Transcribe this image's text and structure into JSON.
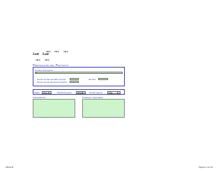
{
  "header": {
    "small_labels_row1": [
      "ABLE",
      "ABLE",
      "ABLE"
    ],
    "logo_left": "Lote",
    "logo_right": "Lote",
    "small_labels_row2": [
      "ABLE",
      "ABLE"
    ]
  },
  "section": {
    "title": "Preparación del Proyecto"
  },
  "project": {
    "name_label": "Nombre del proyecto:",
    "name_value": "0",
    "row1_label": "Número de días que faltan proyecto:",
    "row2_label": "Número de días que lleva la iniciativa:",
    "right_label": "día inicio:"
  },
  "band": {
    "etapa_label": "Etapa",
    "etapa_value": "Inicio",
    "fecha_label": "Fecha Proyecto",
    "fecha_value": "Mockups",
    "fecha_ingreso_label": "Fecha Ingreso",
    "fecha_ingreso_value": "Fase"
  },
  "areas": {
    "left_title": "Antecedentes",
    "right_title": "Problema / Necesidad"
  },
  "footer": {
    "left": "28/04/11",
    "right": "Página 1 de 18"
  }
}
